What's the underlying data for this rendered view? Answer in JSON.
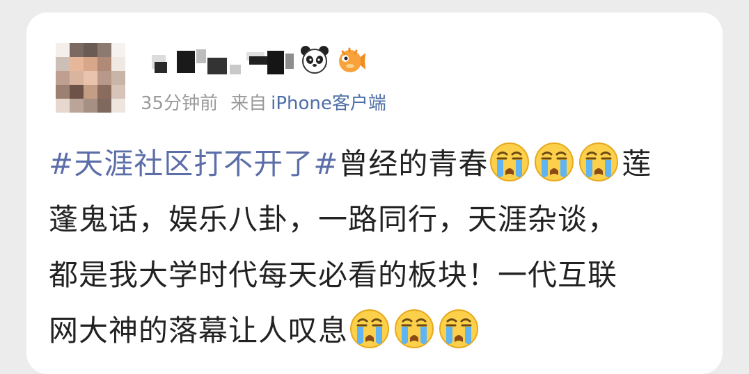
{
  "post": {
    "time": "35分钟前",
    "from_label": "来自",
    "client": "iPhone客户端",
    "badges": [
      "panda-icon",
      "pufferfish-icon"
    ],
    "lines": [
      [
        {
          "type": "topic",
          "text": "#天涯社区打不开了#"
        },
        {
          "type": "text",
          "text": "曾经的青春"
        },
        {
          "type": "emoji",
          "name": "crying-face-icon"
        },
        {
          "type": "emoji",
          "name": "crying-face-icon"
        },
        {
          "type": "emoji",
          "name": "crying-face-icon"
        },
        {
          "type": "text",
          "text": "莲"
        }
      ],
      [
        {
          "type": "text",
          "text": "蓬鬼话，娱乐八卦，一路同行，天涯杂谈，"
        }
      ],
      [
        {
          "type": "text",
          "text": "都是我大学时代每天必看的板块！一代互联"
        }
      ],
      [
        {
          "type": "text",
          "text": "网大神的落幕让人叹息"
        },
        {
          "type": "emoji",
          "name": "crying-face-icon"
        },
        {
          "type": "emoji",
          "name": "crying-face-icon"
        },
        {
          "type": "emoji",
          "name": "crying-face-icon"
        }
      ]
    ]
  }
}
